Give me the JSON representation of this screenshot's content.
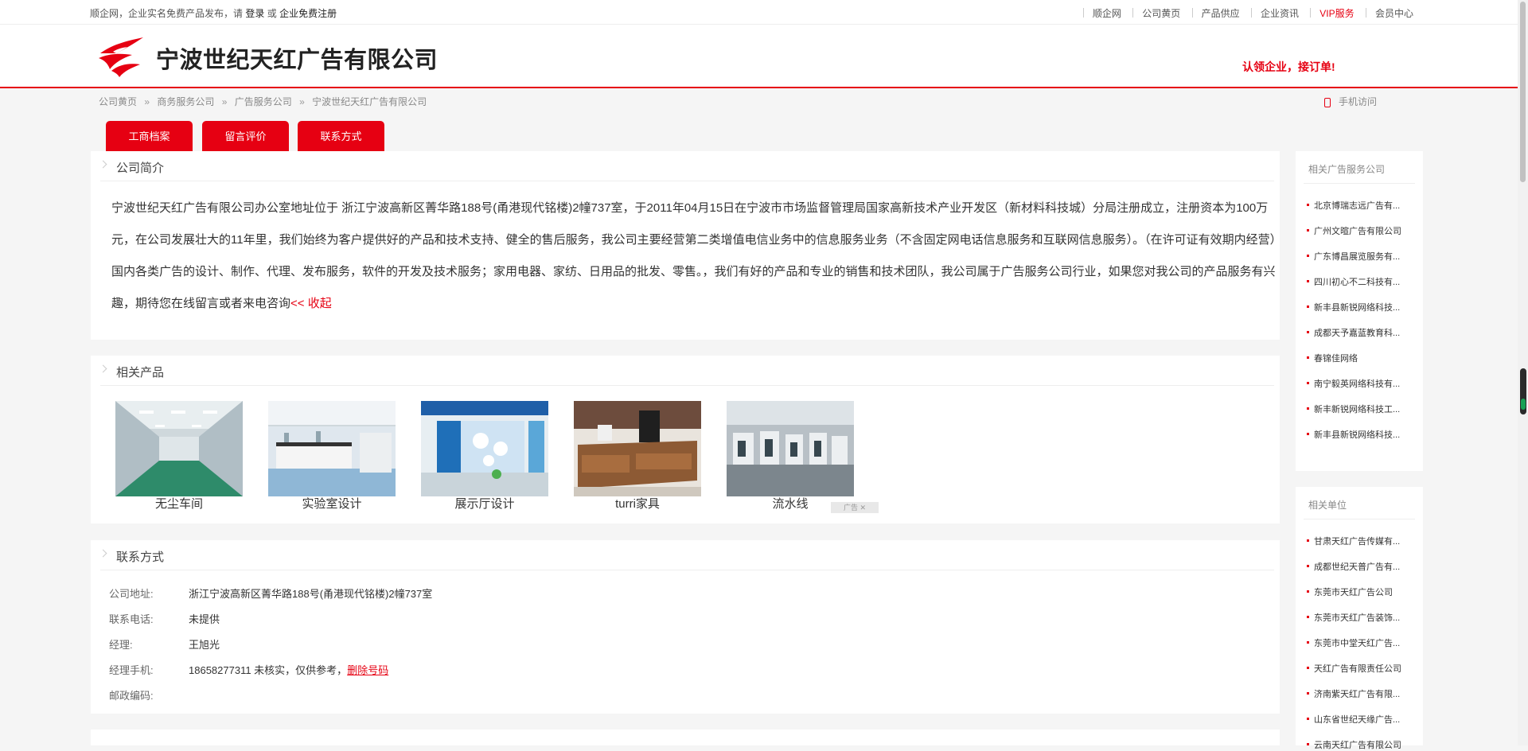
{
  "topbar": {
    "notice_prefix": "顺企网，企业实名免费产品发布，请",
    "login": "登录",
    "or": "或",
    "register": "企业免费注册",
    "links": [
      "顺企网",
      "公司黄页",
      "产品供应",
      "企业资讯",
      "VIP服务",
      "会员中心"
    ]
  },
  "header": {
    "company_name": "宁波世纪天红广告有限公司",
    "claim": "认领企业，接订单!"
  },
  "breadcrumb": {
    "items": [
      "公司黄页",
      "商务服务公司",
      "广告服务公司",
      "宁波世纪天红广告有限公司"
    ],
    "separator": "»",
    "mobile": "手机访问"
  },
  "tabs": [
    "工商档案",
    "留言评价",
    "联系方式"
  ],
  "intro": {
    "title": "公司简介",
    "text": "宁波世纪天红广告有限公司办公室地址位于 浙江宁波高新区菁华路188号(甬港现代铭楼)2幢737室，于2011年04月15日在宁波市市场监督管理局国家高新技术产业开发区（新材料科技城）分局注册成立，注册资本为100万元，在公司发展壮大的11年里，我们始终为客户提供好的产品和技术支持、健全的售后服务，我公司主要经营第二类增值电信业务中的信息服务业务（不含固定网电话信息服务和互联网信息服务）。（在许可证有效期内经营）国内各类广告的设计、制作、代理、发布服务，软件的开发及技术服务；家用电器、家纺、日用品的批发、零售。，我们有好的产品和专业的销售和技术团队，我公司属于广告服务公司行业，如果您对我公司的产品服务有兴趣，期待您在线留言或者来电咨询",
    "collapse": "<< 收起"
  },
  "products": {
    "title": "相关产品",
    "items": [
      {
        "name": "无尘车间"
      },
      {
        "name": "实验室设计"
      },
      {
        "name": "展示厅设计"
      },
      {
        "name": "turri家具"
      },
      {
        "name": "流水线"
      }
    ],
    "ad_label": "广告"
  },
  "contact": {
    "title": "联系方式",
    "address_label": "公司地址:",
    "address": "浙江宁波高新区菁华路188号(甬港现代铭楼)2幢737室",
    "phone_label": "联系电话:",
    "phone": "未提供",
    "manager_label": "经理:",
    "manager": "王旭光",
    "mobile_label": "经理手机:",
    "mobile": "18658277311 未核实，仅供参考，",
    "delete": "删除号码",
    "zip_label": "邮政编码:"
  },
  "sidebar_related": {
    "title": "相关广告服务公司",
    "items": [
      "北京博瑞志远广告有...",
      "广州文暄广告有限公司",
      "广东博昌展览服务有...",
      "四川初心不二科技有...",
      "新丰县新锐网络科技...",
      "成都天予嘉蓝教育科...",
      "春锦佳网络",
      "南宁毅英网络科技有...",
      "新丰新锐网络科技工...",
      "新丰县新锐网络科技..."
    ]
  },
  "sidebar_units": {
    "title": "相关单位",
    "items": [
      "甘肃天红广告传媒有...",
      "成都世纪天普广告有...",
      "东莞市天红广告公司",
      "东莞市天红广告装饰...",
      "东莞市中堂天红广告...",
      "天红广告有限责任公司",
      "济南紫天红广告有限...",
      "山东省世纪天缘广告...",
      "云南天红广告有限公司"
    ]
  },
  "colors": {
    "brand_red": "#e60012",
    "background": "#f5f5f5"
  }
}
